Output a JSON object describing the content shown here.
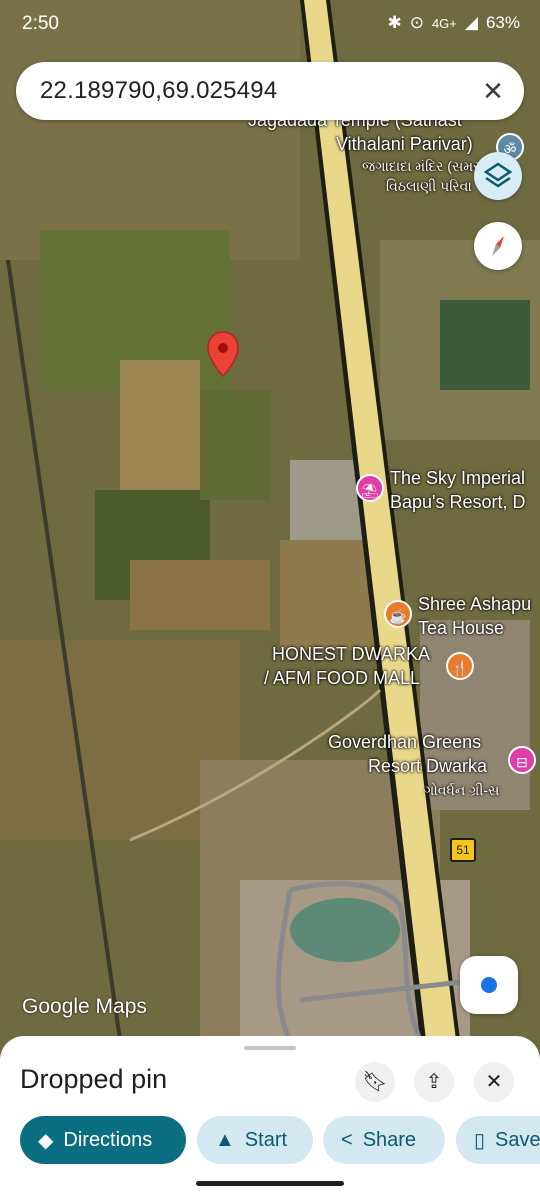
{
  "status_bar": {
    "time": "2:50",
    "network": "4G+",
    "battery": "63%"
  },
  "search": {
    "query": "22.189790,69.025494"
  },
  "map_labels": {
    "temple_en_1": "Jagadada Temple (Satnast",
    "temple_en_2": "Vithalani Parivar)",
    "temple_gu_1": "જગાદાદા મંદિર (સમસ્",
    "temple_gu_2": "વિઠલાણી પરિવા",
    "sky_1": "The Sky Imperial",
    "sky_2": "Bapu's Resort, D",
    "tea_1": "Shree Ashapu",
    "tea_2": "Tea House",
    "food_1": "HONEST DWARKA",
    "food_2": "/ AFM FOOD MALL",
    "gov_1": "Goverdhan Greens",
    "gov_2": "Resort Dwarka",
    "gov_gu": "ગોવર્ધન ગ્રી-સ",
    "route": "51"
  },
  "attribution": "Google Maps",
  "sheet": {
    "title": "Dropped pin",
    "actions": {
      "directions": "Directions",
      "start": "Start",
      "share": "Share",
      "save": "Save"
    }
  },
  "icons": [
    "layers-icon",
    "compass-icon",
    "my-location-icon",
    "bookmark-icon",
    "share-icon",
    "close-icon",
    "pin-icon"
  ],
  "colors": {
    "accent": "#0b6e80",
    "pin": "#ea4335",
    "road": "#e9d78a"
  }
}
